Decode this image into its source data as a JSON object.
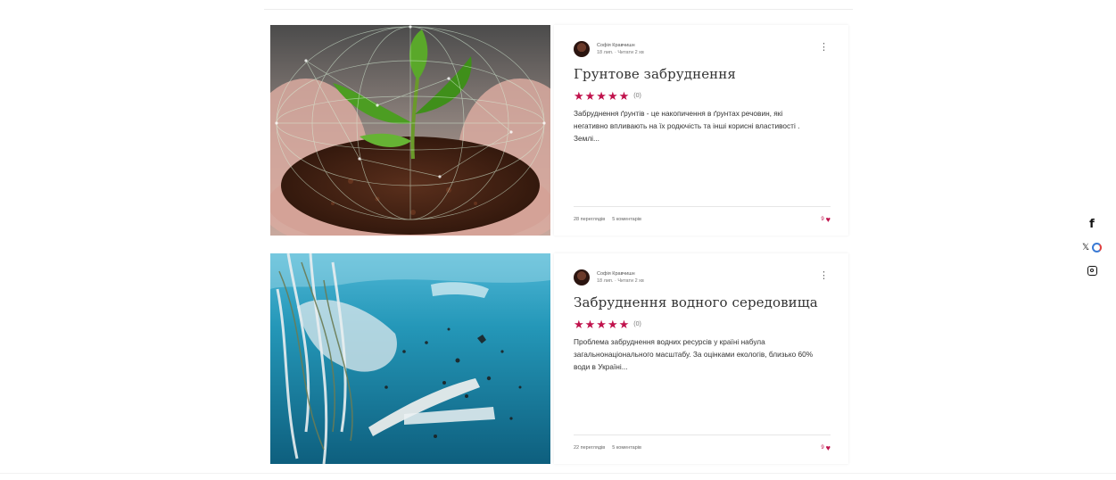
{
  "posts": [
    {
      "author": "Софія Кравчишн",
      "date": "18 лип.",
      "read_time": "Читати 2 хв",
      "title": "Грунтове забруднення",
      "rating_count": "(0)",
      "stars": "★★★★★",
      "excerpt": "Забруднення ґрунтів - це накопичення в ґрунтах речовин, які негативно впливають на їх родючість та інші корисні властивості . Землі...",
      "views": "28 переглядів",
      "comments": "5 коментарів",
      "likes": "9",
      "image": "hands-soil-plant"
    },
    {
      "author": "Софія Кравчишн",
      "date": "18 лип.",
      "read_time": "Читати 2 хв",
      "title": "Забруднення водного середовища",
      "rating_count": "(0)",
      "stars": "★★★★★",
      "excerpt": "Проблема забруднення водних ресурсів у країні набула загальнонаціонального масштабу. За оцінками екологів, близько 60% води в Україні...",
      "views": "22 переглядів",
      "comments": "5 коментарів",
      "likes": "9",
      "image": "plastic-in-ocean"
    }
  ],
  "menu_glyph": "⋮",
  "heart_glyph": "♥",
  "social": {
    "facebook": "f",
    "x": "𝕏",
    "icons": [
      "facebook-icon",
      "x-icon",
      "instagram-icon"
    ]
  },
  "colors": {
    "accent": "#c0124c",
    "background": "#ffffff"
  }
}
